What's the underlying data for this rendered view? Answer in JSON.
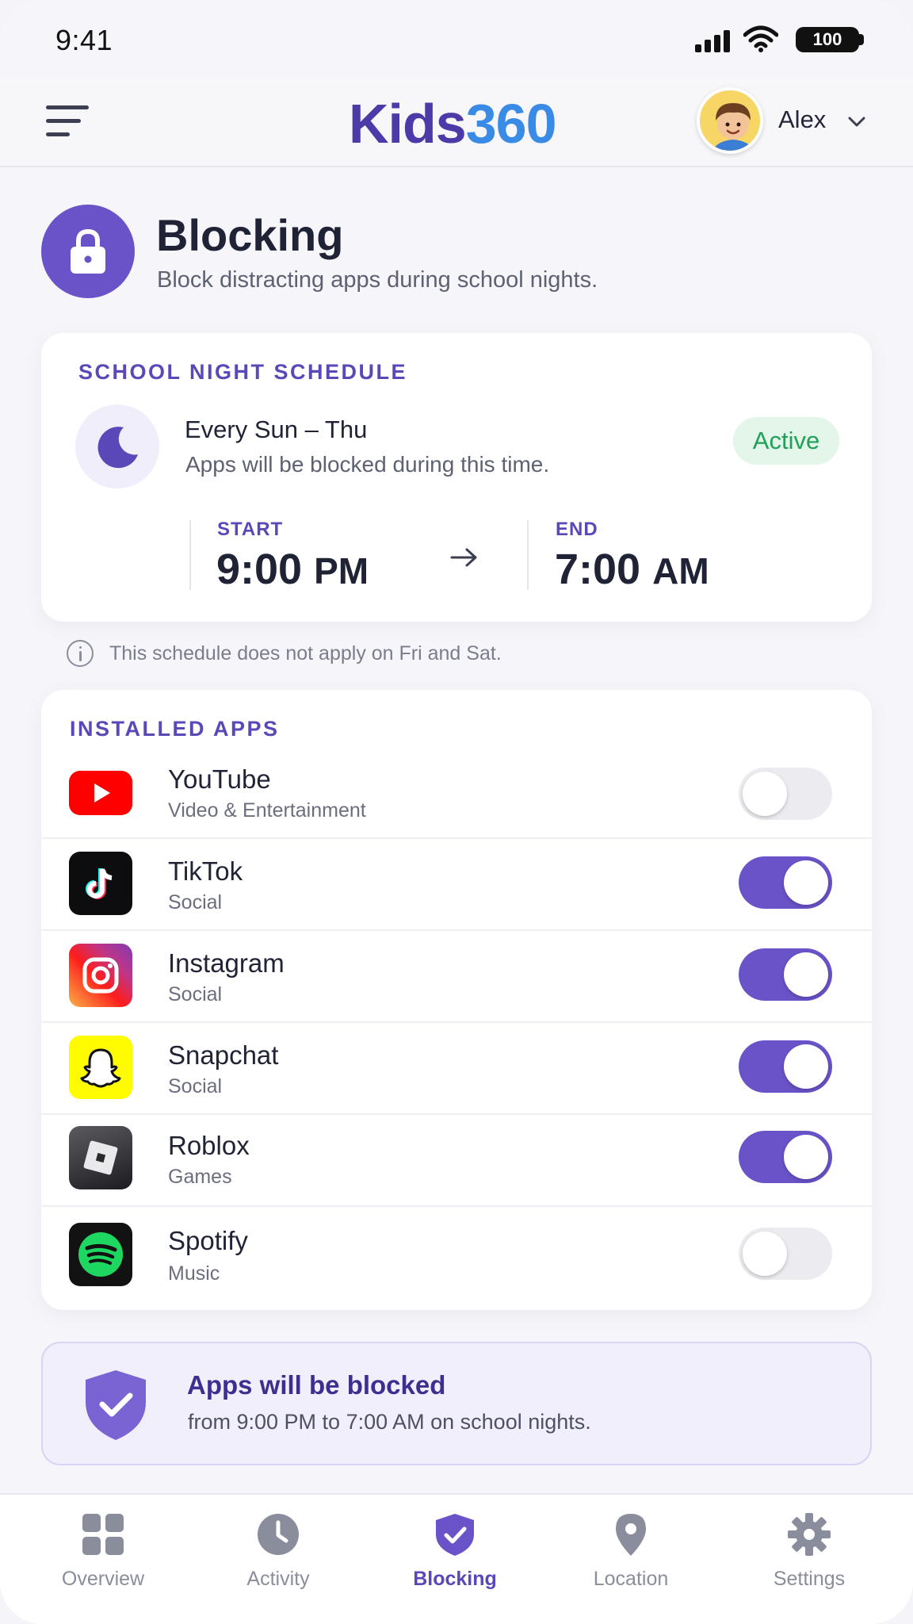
{
  "status_bar": {
    "time": "9:41",
    "battery": "100"
  },
  "header": {
    "logo_part1": "Kids",
    "logo_part2": "360",
    "user_name": "Alex"
  },
  "page": {
    "title": "Blocking",
    "subtitle": "Block distracting apps during school nights."
  },
  "schedule": {
    "section_label": "SCHOOL NIGHT SCHEDULE",
    "days": "Every Sun – Thu",
    "description": "Apps will be blocked during this time.",
    "status": "Active",
    "start_label": "START",
    "start_time": "9:00",
    "start_ampm": "PM",
    "end_label": "END",
    "end_time": "7:00",
    "end_ampm": "AM",
    "note": "This schedule does not apply on Fri and Sat."
  },
  "apps": {
    "section_label": "INSTALLED APPS",
    "items": [
      {
        "name": "YouTube",
        "category": "Video & Entertainment",
        "blocked": false,
        "icon": "youtube-icon"
      },
      {
        "name": "TikTok",
        "category": "Social",
        "blocked": true,
        "icon": "tiktok-icon"
      },
      {
        "name": "Instagram",
        "category": "Social",
        "blocked": true,
        "icon": "instagram-icon"
      },
      {
        "name": "Snapchat",
        "category": "Social",
        "blocked": true,
        "icon": "snapchat-icon"
      },
      {
        "name": "Roblox",
        "category": "Games",
        "blocked": true,
        "icon": "roblox-icon"
      },
      {
        "name": "Spotify",
        "category": "Music",
        "blocked": false,
        "icon": "spotify-icon"
      }
    ]
  },
  "banner": {
    "title": "Apps will be blocked",
    "text": "from 9:00 PM to 7:00 AM on school nights."
  },
  "nav": {
    "items": [
      {
        "label": "Overview",
        "icon": "grid-icon",
        "active": false
      },
      {
        "label": "Activity",
        "icon": "clock-icon",
        "active": false
      },
      {
        "label": "Blocking",
        "icon": "shield-check-icon",
        "active": true
      },
      {
        "label": "Location",
        "icon": "map-pin-icon",
        "active": false
      },
      {
        "label": "Settings",
        "icon": "gear-icon",
        "active": false
      }
    ]
  },
  "colors": {
    "accent": "#6a52c9",
    "accent_text": "#5a48b8",
    "active_green": "#21a158"
  }
}
